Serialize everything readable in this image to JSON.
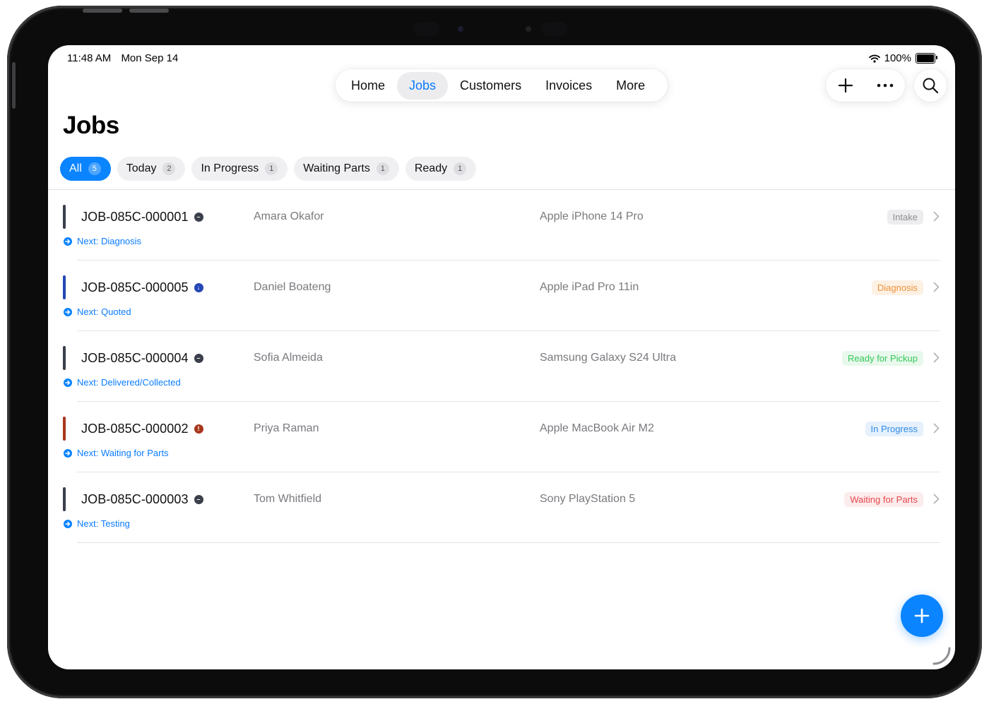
{
  "status_bar": {
    "time": "11:48 AM",
    "date": "Mon Sep 14",
    "battery": "100%",
    "battery_level": 1.0
  },
  "nav": {
    "tabs": [
      {
        "label": "Home",
        "active": false
      },
      {
        "label": "Jobs",
        "active": true
      },
      {
        "label": "Customers",
        "active": false
      },
      {
        "label": "Invoices",
        "active": false
      },
      {
        "label": "More",
        "active": false
      }
    ],
    "actions": {
      "add_icon": "plus-icon",
      "more_icon": "ellipsis-icon",
      "search_icon": "search-icon"
    }
  },
  "page": {
    "title": "Jobs"
  },
  "filters": [
    {
      "label": "All",
      "count": "5",
      "active": true
    },
    {
      "label": "Today",
      "count": "2",
      "active": false
    },
    {
      "label": "In Progress",
      "count": "1",
      "active": false
    },
    {
      "label": "Waiting Parts",
      "count": "1",
      "active": false
    },
    {
      "label": "Ready",
      "count": "1",
      "active": false
    }
  ],
  "jobs": [
    {
      "id": "JOB-085C-000001",
      "customer": "Amara Okafor",
      "device": "Apple iPhone 14 Pro",
      "status": "Intake",
      "next": "Next: Diagnosis",
      "priority_icon": "minus-circle-icon",
      "bar_color": "#3a3f4b",
      "dot_color": "#3a3f4b",
      "badge_bg": "#ededef",
      "badge_fg": "#8e8e93"
    },
    {
      "id": "JOB-085C-000005",
      "customer": "Daniel Boateng",
      "device": "Apple iPad Pro 11in",
      "status": "Diagnosis",
      "next": "Next: Quoted",
      "priority_icon": "arrow-down-circle-icon",
      "bar_color": "#2346b5",
      "dot_color": "#2346b5",
      "badge_bg": "#fdf1e4",
      "badge_fg": "#f0923a"
    },
    {
      "id": "JOB-085C-000004",
      "customer": "Sofia Almeida",
      "device": "Samsung Galaxy S24 Ultra",
      "status": "Ready for Pickup",
      "next": "Next: Delivered/Collected",
      "priority_icon": "minus-circle-icon",
      "bar_color": "#3a3f4b",
      "dot_color": "#3a3f4b",
      "badge_bg": "#e8f8ec",
      "badge_fg": "#34c759"
    },
    {
      "id": "JOB-085C-000002",
      "customer": "Priya Raman",
      "device": "Apple MacBook Air M2",
      "status": "In Progress",
      "next": "Next: Waiting for Parts",
      "priority_icon": "exclamation-circle-icon",
      "bar_color": "#a8361c",
      "dot_color": "#a8361c",
      "badge_bg": "#e6f1fd",
      "badge_fg": "#2f8be6"
    },
    {
      "id": "JOB-085C-000003",
      "customer": "Tom Whitfield",
      "device": "Sony PlayStation 5",
      "status": "Waiting for Parts",
      "next": "Next: Testing",
      "priority_icon": "minus-circle-icon",
      "bar_color": "#3a3f4b",
      "dot_color": "#3a3f4b",
      "badge_bg": "#fdecec",
      "badge_fg": "#e5484d"
    }
  ],
  "fab": {
    "icon": "plus-icon"
  }
}
